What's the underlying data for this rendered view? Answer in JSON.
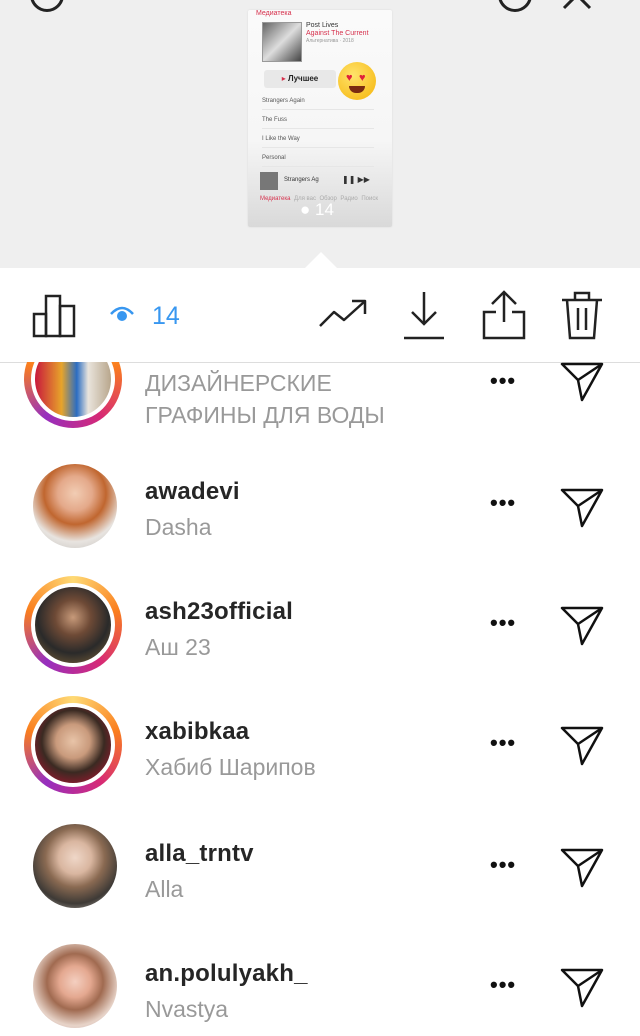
{
  "story_preview": {
    "header": "Медиатека",
    "album_title": "Post Lives",
    "album_artist": "Against The Current",
    "album_sub": "Альтернатива · 2018",
    "best_label": "Лучшее",
    "tracks": [
      "Strangers Again",
      "The Fuss",
      "I Like the Way",
      "Personal"
    ],
    "now_playing": "Strangers Ag",
    "controls": "❚❚ ▶▶",
    "tabs": [
      "Медиатека",
      "Для вас",
      "Обзор",
      "Радио",
      "Поиск"
    ],
    "views_overlay": "14"
  },
  "toolbar": {
    "views_count": "14",
    "accent_color": "#3897f0",
    "icons": [
      "bar-chart-icon",
      "eye-icon",
      "trending-icon",
      "download-icon",
      "share-icon",
      "trash-icon"
    ]
  },
  "viewers": [
    {
      "username": "",
      "full_name_line1": "ДИЗАЙНЕРСКИЕ",
      "full_name_line2": "ГРАФИНЫ ДЛЯ ВОДЫ",
      "ring": true
    },
    {
      "username": "awadevi",
      "full_name": "Dasha",
      "ring": false
    },
    {
      "username": "ash23official",
      "full_name": "Аш 23",
      "ring": true
    },
    {
      "username": "xabibkaa",
      "full_name": "Хабиб Шарипов",
      "ring": true
    },
    {
      "username": "alla_trntv",
      "full_name": "Alla",
      "ring": false
    },
    {
      "username": "an.polulyakh_",
      "full_name": "Nvastya",
      "ring": false
    }
  ],
  "more_label": "•••"
}
